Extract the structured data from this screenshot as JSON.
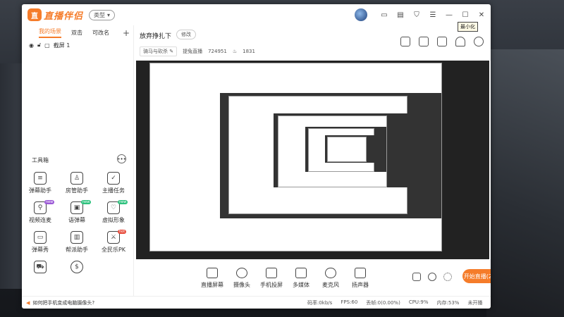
{
  "app": {
    "logo_badge": "直",
    "name": "直播伴侣",
    "type_label": "类型",
    "tooltip": "最小化"
  },
  "colors": {
    "accent": "#f57c2a"
  },
  "sidebar": {
    "tabs": [
      "我的场景",
      "双击",
      "可改名"
    ],
    "source_name": "截屏 1",
    "tools_title": "工具箱",
    "tools": [
      {
        "label": "弹幕助手",
        "icon": "chat-icon",
        "tag": ""
      },
      {
        "label": "房管助手",
        "icon": "admin-icon",
        "tag": ""
      },
      {
        "label": "主播任务",
        "icon": "task-icon",
        "tag": ""
      },
      {
        "label": "视频连麦",
        "icon": "video-link-icon",
        "tag": "new"
      },
      {
        "label": "语弹幕",
        "icon": "voice-danmaku-icon",
        "tag": "new"
      },
      {
        "label": "虚拟形象",
        "icon": "avatar-icon",
        "tag": "new"
      },
      {
        "label": "弹幕秀",
        "icon": "tv-icon",
        "tag": ""
      },
      {
        "label": "帮派助手",
        "icon": "gang-icon",
        "tag": ""
      },
      {
        "label": "全民乐PK",
        "icon": "pk-icon",
        "tag": "hot"
      },
      {
        "label": "",
        "icon": "car-icon",
        "tag": ""
      },
      {
        "label": "",
        "icon": "money-icon",
        "tag": ""
      }
    ]
  },
  "main": {
    "scene_name": "放弃挣扎下",
    "edit_label": "修改",
    "game": "骑马与砍杀",
    "room_label": "提兔直播",
    "room_id": "724951",
    "fans": "1831",
    "controls": [
      "直播屏幕",
      "摄像头",
      "手机投屏",
      "多媒体",
      "麦克风",
      "扬声器"
    ],
    "go_live": "开始直播(23s)"
  },
  "status": {
    "tip": "如何把手机变成电脑摄像头?",
    "bitrate": "码率:0kb/s",
    "fps": "FPS:60",
    "dropped": "丢帧:0(0.00%)",
    "cpu": "CPU:9%",
    "mem": "内存:53%",
    "unopened": "未开播"
  }
}
